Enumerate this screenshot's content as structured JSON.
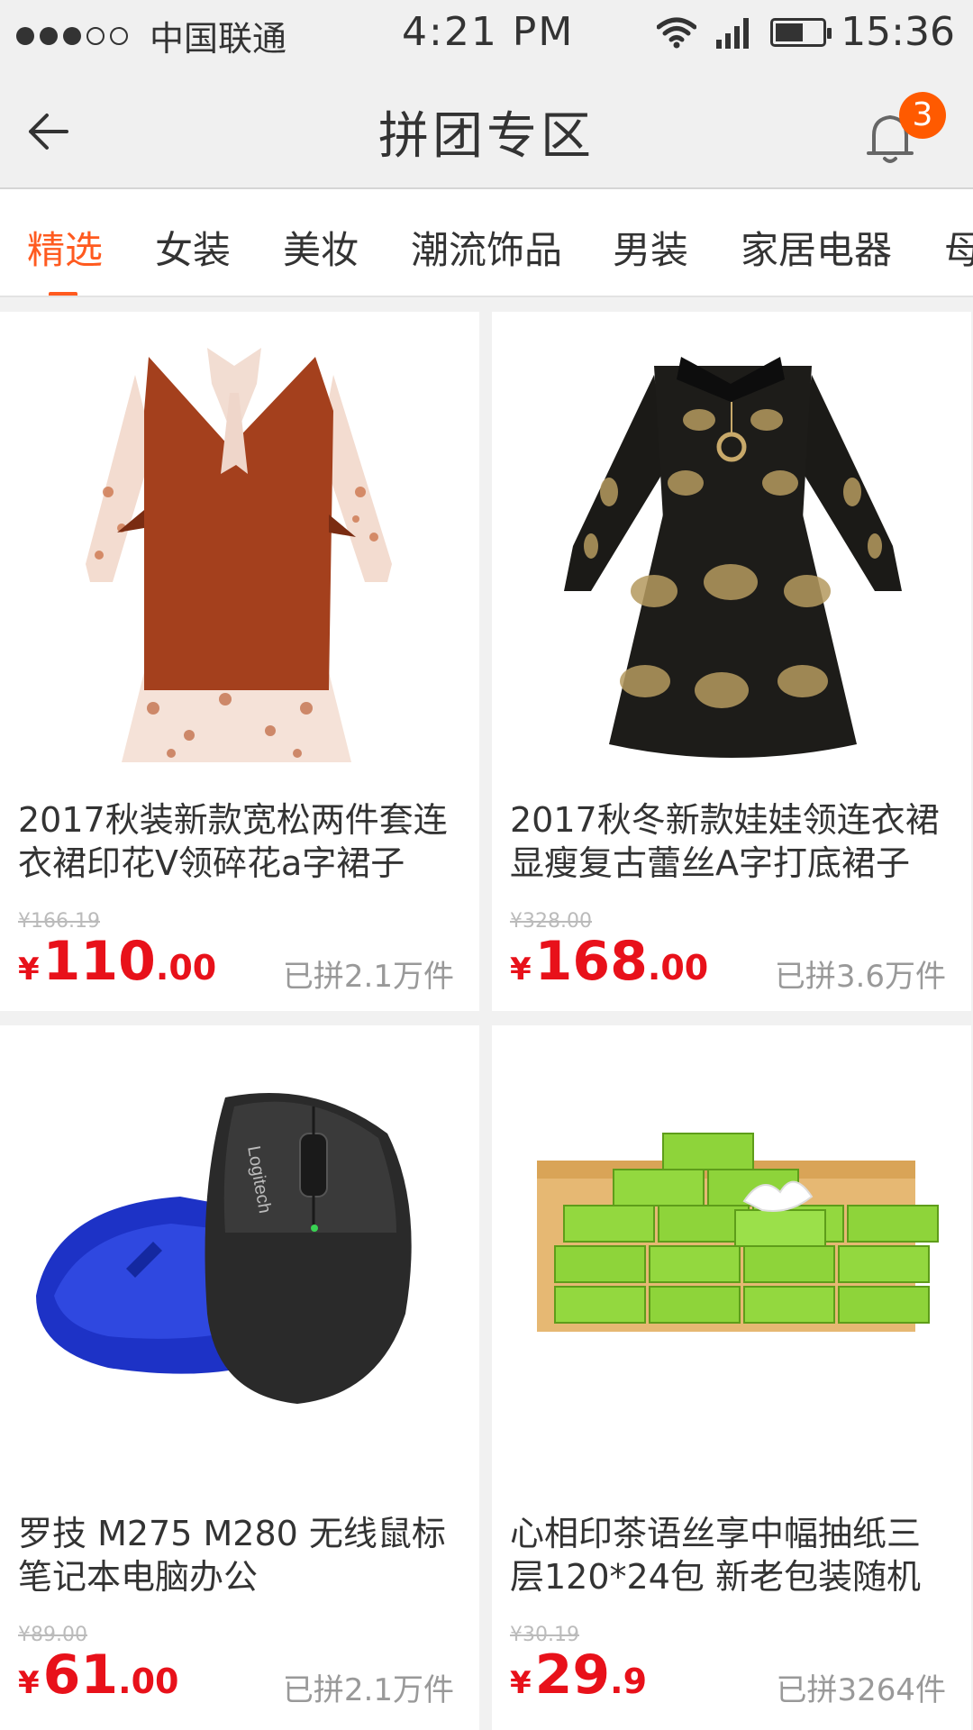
{
  "status_bar": {
    "carrier": "中国联通",
    "time_center": "4:21 PM",
    "time_right": "15:36",
    "signal_dots_filled": 3,
    "signal_dots_total": 5,
    "battery_level": 0.6
  },
  "nav": {
    "title": "拼团专区",
    "back_icon": "back-arrow-icon",
    "bell_icon": "bell-icon",
    "notification_count": "3"
  },
  "tabs": [
    {
      "label": "精选",
      "active": true
    },
    {
      "label": "女装",
      "active": false
    },
    {
      "label": "美妆",
      "active": false
    },
    {
      "label": "潮流饰品",
      "active": false
    },
    {
      "label": "男装",
      "active": false
    },
    {
      "label": "家居电器",
      "active": false
    },
    {
      "label": "母",
      "active": false
    }
  ],
  "products": [
    {
      "title": "2017秋装新款宽松两件套连衣裙印花V领碎花a字裙子",
      "original_price": "¥166.19",
      "currency": "¥",
      "price_int": "110",
      "price_dec": ".00",
      "sold": "已拼2.1万件"
    },
    {
      "title": "2017秋冬新款娃娃领连衣裙显瘦复古蕾丝A字打底裙子",
      "original_price": "¥328.00",
      "currency": "¥",
      "price_int": "168",
      "price_dec": ".00",
      "sold": "已拼3.6万件"
    },
    {
      "title": "罗技 M275 M280 无线鼠标笔记本电脑办公",
      "original_price": "¥89.00",
      "currency": "¥",
      "price_int": "61",
      "price_dec": ".00",
      "sold": "已拼2.1万件",
      "image_text": "Logitech"
    },
    {
      "title": "心相印茶语丝享中幅抽纸三层120*24包 新老包装随机",
      "original_price": "¥30.19",
      "currency": "¥",
      "price_int": "29",
      "price_dec": ".9",
      "sold": "已拼3264件"
    }
  ],
  "colors": {
    "accent": "#ff5a1f",
    "price": "#e8111a",
    "badge": "#ff5a00"
  }
}
